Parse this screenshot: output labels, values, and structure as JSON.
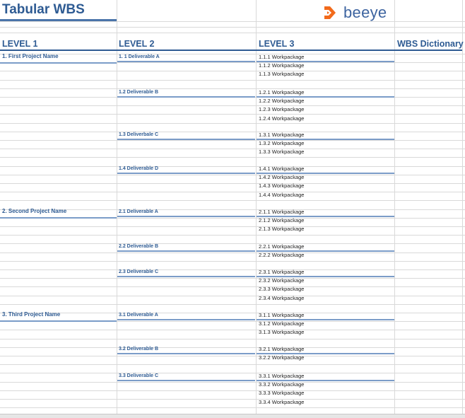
{
  "sheet": {
    "title": "Tabular WBS",
    "logo_text": "beeye",
    "logo_color": "#f26a1b",
    "brand_color": "#2e5b93",
    "headers": [
      "LEVEL 1",
      "LEVEL 2",
      "LEVEL 3",
      "WBS Dictionary"
    ]
  },
  "projects": [
    {
      "name": "1. First Project Name",
      "deliverables": [
        {
          "name": "1. 1 Deliverable A",
          "packages": [
            "1.1.1 Workpackage",
            "1.1.2 Workpackage",
            "1.1.3 Workpackage"
          ]
        },
        {
          "name": "1.2 Deliverable B",
          "packages": [
            "1.2.1 Workpackage",
            "1.2.2 Workpackage",
            "1.2.3 Workpackage",
            "1.2.4 Workpackage"
          ]
        },
        {
          "name": "1.3 Deliverbale C",
          "packages": [
            "1.3.1 Workpackage",
            "1.3.2 Workpackage",
            "1.3.3 Workpackage"
          ]
        },
        {
          "name": "1.4 Deliverable D",
          "packages": [
            "1.4.1 Workpackage",
            "1.4.2 Workpackage",
            "1.4.3 Workpackage",
            "1.4.4 Workpackage"
          ]
        }
      ]
    },
    {
      "name": "2. Second Project Name",
      "deliverables": [
        {
          "name": "2.1 Deliverable A",
          "packages": [
            "2.1.1 Workpackage",
            "2.1.2 Workpackage",
            "2.1.3 Workpackage"
          ]
        },
        {
          "name": "2.2 Deliverable B",
          "packages": [
            "2.2.1 Workpackage",
            "2.2.2 Workpackage"
          ]
        },
        {
          "name": "2.3 Deliverable C",
          "packages": [
            "2.3.1 Workpackage",
            "2.3.2 Workpackage",
            "2.3.3 Workpackage",
            "2.3.4 Workpackage"
          ]
        }
      ]
    },
    {
      "name": "3. Third Project Name",
      "deliverables": [
        {
          "name": "3.1 Deliverable A",
          "packages": [
            "3.1.1 Workpackage",
            "3.1.2 Workpackage",
            "3.1.3 Workpackage"
          ]
        },
        {
          "name": "3.2 Deliverable B",
          "packages": [
            "3.2.1 Workpackage",
            "3.2.2 Workpackage"
          ]
        },
        {
          "name": "3.3 Deliverable C",
          "packages": [
            "3.3.1 Workpackage",
            "3.3.2 Workpackage",
            "3.3.3 Workpackage",
            "3.3.4 Workpackage"
          ]
        }
      ]
    }
  ]
}
